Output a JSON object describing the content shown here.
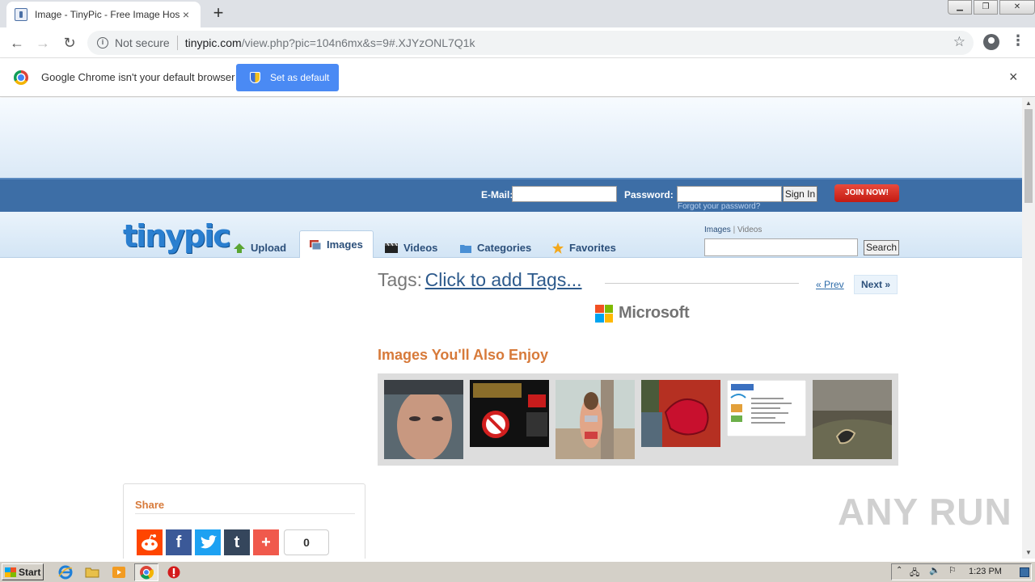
{
  "browser": {
    "tab_title": "Image - TinyPic - Free Image Hosting",
    "new_tab": "+",
    "close_tab": "×",
    "security": "Not secure",
    "url_host": "tinypic.com",
    "url_path": "/view.php?pic=104n6mx&s=9#.XJYzONL7Q1k",
    "infobar_message": "Google Chrome isn't your default browser",
    "set_default_label": "Set as default",
    "infobar_close": "×"
  },
  "login": {
    "email_label": "E-Mail:",
    "password_label": "Password:",
    "signin_label": "Sign In",
    "forgot_label": "Forgot your password?",
    "join_label": "JOIN NOW!"
  },
  "nav": {
    "logo": "tinypic",
    "tabs": [
      {
        "label": "Upload",
        "icon": "upload-arrow-icon"
      },
      {
        "label": "Images",
        "icon": "images-icon"
      },
      {
        "label": "Videos",
        "icon": "clapperboard-icon"
      },
      {
        "label": "Categories",
        "icon": "folder-icon"
      },
      {
        "label": "Favorites",
        "icon": "star-icon"
      }
    ],
    "active_tab": "Images",
    "search_scope_images": "Images",
    "search_scope_sep": "|",
    "search_scope_videos": "Videos",
    "search_button": "Search"
  },
  "content": {
    "tags_label": "Tags:",
    "tags_link": "Click to add Tags...",
    "prev_label": "« Prev",
    "next_label": "Next »",
    "image_brand": "Microsoft",
    "enjoy_heading": "Images You'll Also Enjoy",
    "share_heading": "Share",
    "share_count": "0",
    "share_buttons": [
      {
        "name": "reddit",
        "glyph": "",
        "color": "#ff4500"
      },
      {
        "name": "facebook",
        "glyph": "f",
        "color": "#3b5998"
      },
      {
        "name": "twitter",
        "glyph": "",
        "color": "#1da1f2"
      },
      {
        "name": "tumblr",
        "glyph": "t",
        "color": "#35465c"
      },
      {
        "name": "more",
        "glyph": "+",
        "color": "#f0594c"
      }
    ],
    "watermark": "ANY RUN"
  },
  "taskbar": {
    "start_label": "Start",
    "time": "1:23 PM"
  }
}
